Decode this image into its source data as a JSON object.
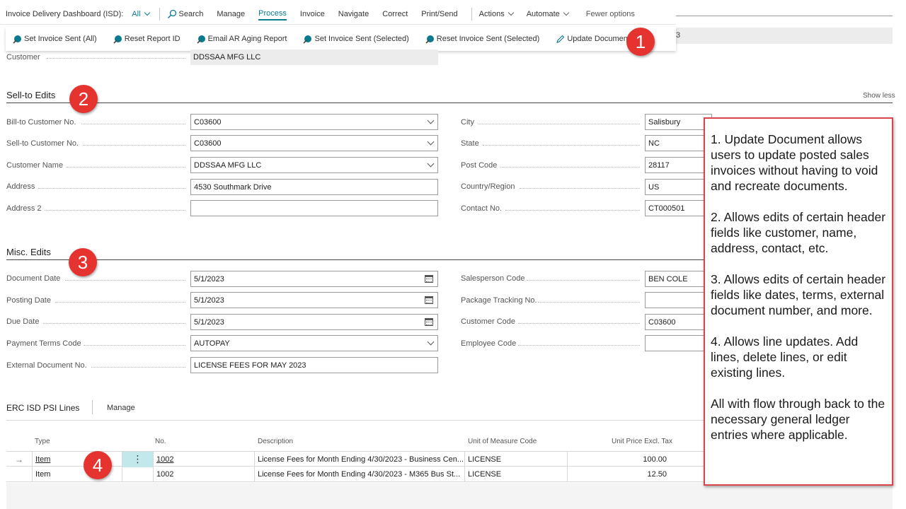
{
  "topnav": {
    "page_title": "Invoice Delivery Dashboard (ISD):",
    "filter": "All",
    "items": [
      "Search",
      "Manage",
      "Process",
      "Invoice",
      "Navigate",
      "Correct",
      "Print/Send",
      "Actions",
      "Automate",
      "Fewer options"
    ]
  },
  "actions": [
    "Set Invoice Sent (All)",
    "Reset Report ID",
    "Email AR Aging Report",
    "Set Invoice Sent (Selected)",
    "Reset Invoice Sent (Selected)",
    "Update Document"
  ],
  "partial_value": "3",
  "badges": [
    "1",
    "2",
    "3",
    "4"
  ],
  "customer": {
    "label": "Customer",
    "value": "DDSSAA MFG LLC"
  },
  "sellto": {
    "title": "Sell-to Edits",
    "show_less": "Show less",
    "left": [
      {
        "label": "Bill-to Customer No.",
        "value": "C03600"
      },
      {
        "label": "Sell-to Customer No.",
        "value": "C03600"
      },
      {
        "label": "Customer Name",
        "value": "DDSSAA MFG LLC"
      },
      {
        "label": "Address",
        "value": "4530 Southmark Drive"
      },
      {
        "label": "Address 2",
        "value": ""
      }
    ],
    "right": [
      {
        "label": "City",
        "value": "Salisbury"
      },
      {
        "label": "State",
        "value": "NC"
      },
      {
        "label": "Post Code",
        "value": "28117"
      },
      {
        "label": "Country/Region",
        "value": "US"
      },
      {
        "label": "Contact No.",
        "value": "CT000501"
      }
    ]
  },
  "misc": {
    "title": "Misc. Edits",
    "left": [
      {
        "label": "Document Date",
        "value": "5/1/2023"
      },
      {
        "label": "Posting Date",
        "value": "5/1/2023"
      },
      {
        "label": "Due Date",
        "value": "5/1/2023"
      },
      {
        "label": "Payment Terms Code",
        "value": "AUTOPAY"
      },
      {
        "label": "External Document No.",
        "value": "LICENSE FEES FOR MAY 2023"
      }
    ],
    "right": [
      {
        "label": "Salesperson Code",
        "value": "BEN COLE"
      },
      {
        "label": "Package Tracking No.",
        "value": ""
      },
      {
        "label": "Customer Code",
        "value": "C03600"
      },
      {
        "label": "Employee Code",
        "value": ""
      }
    ]
  },
  "lines": {
    "title": "ERC ISD PSI Lines",
    "manage": "Manage",
    "columns": [
      "Type",
      "No.",
      "Description",
      "Unit of Measure Code",
      "Unit Price Excl. Tax"
    ],
    "rows": [
      {
        "type": "Item",
        "no": "1002",
        "description": "License Fees for Month Ending 4/30/2023 - Business Cen...",
        "uom": "LICENSE",
        "price": "100.00"
      },
      {
        "type": "Item",
        "no": "1002",
        "description": "License Fees for Month Ending 4/30/2023 - M365 Bus St...",
        "uom": "LICENSE",
        "price": "12.50"
      }
    ]
  },
  "notes": [
    "1. Update Document allows users to update posted sales invoices without having to void and recreate documents.",
    "2. Allows edits of certain header fields like customer, name, address, contact, etc.",
    "3. Allows edits of certain header fields like dates, terms, external document number, and more.",
    "4. Allows line updates. Add lines, delete lines, or edit existing lines.",
    "All with flow through back to the necessary general ledger entries where applicable."
  ],
  "colors": {
    "accent": "#0a7a8f",
    "badge": "#e5332f",
    "note_border": "#d9454a",
    "row_highlight": "#c3e8ec"
  }
}
